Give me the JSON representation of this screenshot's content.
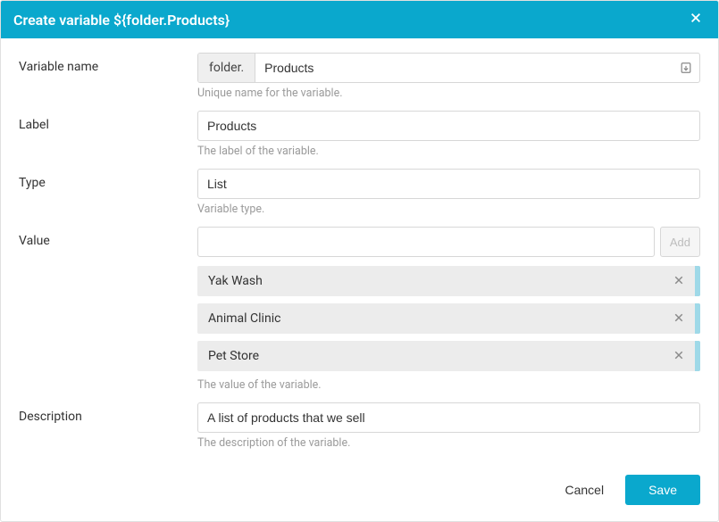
{
  "header": {
    "title": "Create variable ${folder.Products}"
  },
  "fields": {
    "name": {
      "label": "Variable name",
      "prefix": "folder.",
      "value": "Products",
      "hint": "Unique name for the variable."
    },
    "label": {
      "label": "Label",
      "value": "Products",
      "hint": "The label of the variable."
    },
    "type": {
      "label": "Type",
      "value": "List",
      "hint": "Variable type."
    },
    "value": {
      "label": "Value",
      "input": "",
      "add_label": "Add",
      "items": [
        "Yak Wash",
        "Animal Clinic",
        "Pet Store"
      ],
      "hint": "The value of the variable."
    },
    "description": {
      "label": "Description",
      "value": "A list of products that we sell",
      "hint": "The description of the variable."
    }
  },
  "footer": {
    "cancel": "Cancel",
    "save": "Save"
  }
}
